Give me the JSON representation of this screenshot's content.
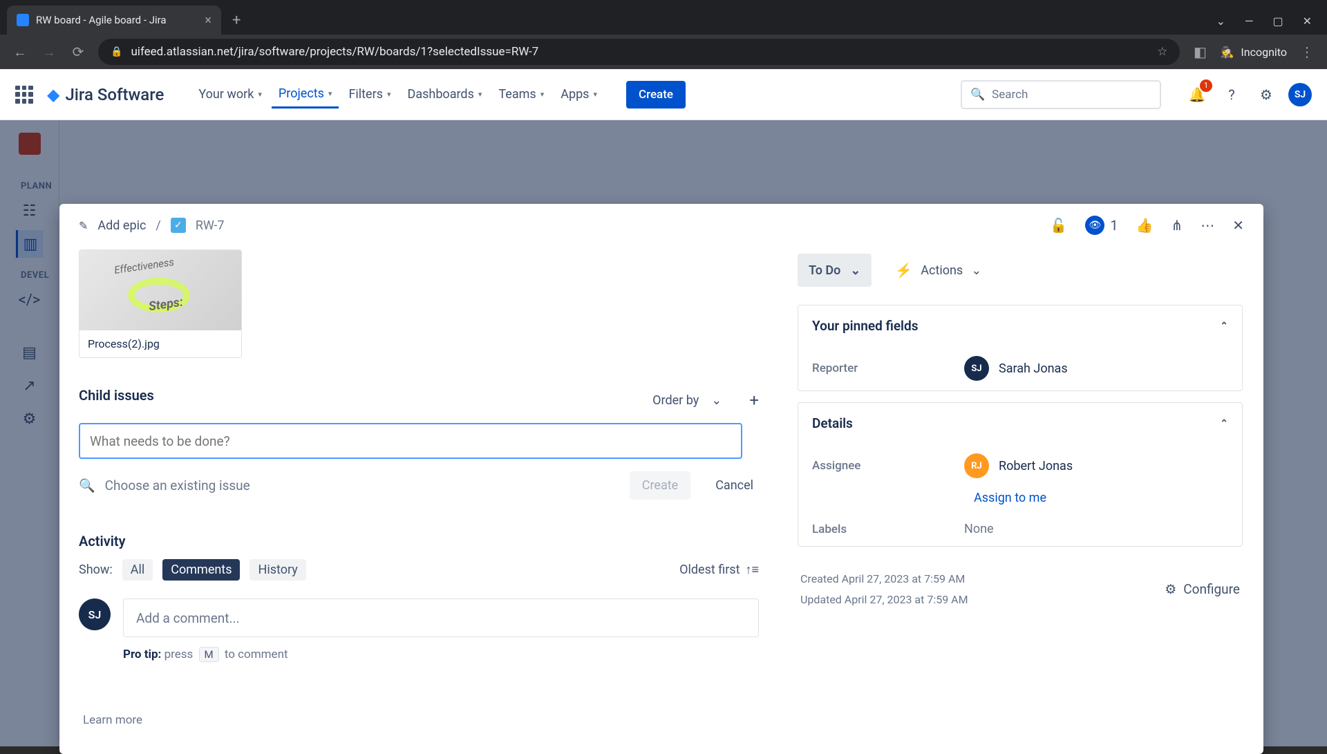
{
  "browser": {
    "tab_title": "RW board - Agile board - Jira",
    "url": "uifeed.atlassian.net/jira/software/projects/RW/boards/1?selectedIssue=RW-7",
    "incognito": "Incognito"
  },
  "topnav": {
    "product": "Jira Software",
    "items": [
      "Your work",
      "Projects",
      "Filters",
      "Dashboards",
      "Teams",
      "Apps"
    ],
    "active_index": 1,
    "create": "Create",
    "search_placeholder": "Search",
    "notif_count": "1",
    "user_initials": "SJ"
  },
  "sidebar": {
    "sections": [
      "PLANN",
      "DEVEL"
    ]
  },
  "issue": {
    "add_epic": "Add epic",
    "key": "RW-7",
    "watch_count": "1",
    "attachment_name": "Process(2).jpg",
    "child_issues_heading": "Child issues",
    "order_by": "Order by",
    "child_placeholder": "What needs to be done?",
    "choose_existing": "Choose an existing issue",
    "create": "Create",
    "cancel": "Cancel",
    "activity_heading": "Activity",
    "show_label": "Show:",
    "tabs": [
      "All",
      "Comments",
      "History"
    ],
    "active_tab": 1,
    "sort": "Oldest first",
    "comment_placeholder": "Add a comment...",
    "protip_bold": "Pro tip:",
    "protip_a": "press",
    "protip_key": "M",
    "protip_b": "to comment",
    "commenter_initials": "SJ"
  },
  "details": {
    "status": "To Do",
    "actions": "Actions",
    "pinned_heading": "Your pinned fields",
    "reporter_label": "Reporter",
    "reporter_initials": "SJ",
    "reporter_name": "Sarah Jonas",
    "details_heading": "Details",
    "assignee_label": "Assignee",
    "assignee_initials": "RJ",
    "assignee_name": "Robert Jonas",
    "assign_to_me": "Assign to me",
    "labels_label": "Labels",
    "labels_value": "None",
    "created": "Created April 27, 2023 at 7:59 AM",
    "updated": "Updated April 27, 2023 at 7:59 AM",
    "configure": "Configure"
  },
  "footer": {
    "learn_more": "Learn more"
  }
}
